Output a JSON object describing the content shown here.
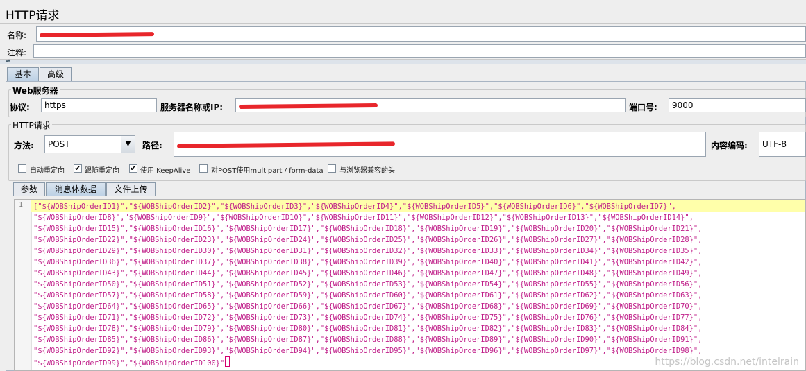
{
  "window": {
    "title": "HTTP请求"
  },
  "name_field": {
    "label": "名称:",
    "value": ""
  },
  "comment_field": {
    "label": "注释:",
    "value": ""
  },
  "tabs_top": [
    {
      "label": "基本",
      "active": true
    },
    {
      "label": "高级",
      "active": false
    }
  ],
  "web_server": {
    "group_label": "Web服务器",
    "protocol_label": "协议:",
    "protocol_value": "https",
    "server_label": "服务器名称或IP:",
    "server_value": "",
    "port_label": "端口号:",
    "port_value": "9000"
  },
  "http_request": {
    "group_label": "HTTP请求",
    "method_label": "方法:",
    "method_value": "POST",
    "path_label": "路径:",
    "path_value": "",
    "encoding_label": "内容编码:",
    "encoding_value": "UTF-8"
  },
  "options": [
    {
      "label": "自动重定向",
      "checked": false
    },
    {
      "label": "跟随重定向",
      "checked": true
    },
    {
      "label": "使用 KeepAlive",
      "checked": true
    },
    {
      "label": "对POST使用multipart / form-data",
      "checked": false
    },
    {
      "label": "与浏览器兼容的头",
      "checked": false
    }
  ],
  "tabs_body": [
    {
      "label": "参数",
      "active": false
    },
    {
      "label": "消息体数据",
      "active": true
    },
    {
      "label": "文件上传",
      "active": false
    }
  ],
  "editor": {
    "line_number": "1",
    "lines": [
      "[\"${WOBShipOrderID1}\",\"${WOBShipOrderID2}\",\"${WOBShipOrderID3}\",\"${WOBShipOrderID4}\",\"${WOBShipOrderID5}\",\"${WOBShipOrderID6}\",\"${WOBShipOrderID7}\",",
      "\"${WOBShipOrderID8}\",\"${WOBShipOrderID9}\",\"${WOBShipOrderID10}\",\"${WOBShipOrderID11}\",\"${WOBShipOrderID12}\",\"${WOBShipOrderID13}\",\"${WOBShipOrderID14}\",",
      "\"${WOBShipOrderID15}\",\"${WOBShipOrderID16}\",\"${WOBShipOrderID17}\",\"${WOBShipOrderID18}\",\"${WOBShipOrderID19}\",\"${WOBShipOrderID20}\",\"${WOBShipOrderID21}\",",
      "\"${WOBShipOrderID22}\",\"${WOBShipOrderID23}\",\"${WOBShipOrderID24}\",\"${WOBShipOrderID25}\",\"${WOBShipOrderID26}\",\"${WOBShipOrderID27}\",\"${WOBShipOrderID28}\",",
      "\"${WOBShipOrderID29}\",\"${WOBShipOrderID30}\",\"${WOBShipOrderID31}\",\"${WOBShipOrderID32}\",\"${WOBShipOrderID33}\",\"${WOBShipOrderID34}\",\"${WOBShipOrderID35}\",",
      "\"${WOBShipOrderID36}\",\"${WOBShipOrderID37}\",\"${WOBShipOrderID38}\",\"${WOBShipOrderID39}\",\"${WOBShipOrderID40}\",\"${WOBShipOrderID41}\",\"${WOBShipOrderID42}\",",
      "\"${WOBShipOrderID43}\",\"${WOBShipOrderID44}\",\"${WOBShipOrderID45}\",\"${WOBShipOrderID46}\",\"${WOBShipOrderID47}\",\"${WOBShipOrderID48}\",\"${WOBShipOrderID49}\",",
      "\"${WOBShipOrderID50}\",\"${WOBShipOrderID51}\",\"${WOBShipOrderID52}\",\"${WOBShipOrderID53}\",\"${WOBShipOrderID54}\",\"${WOBShipOrderID55}\",\"${WOBShipOrderID56}\",",
      "\"${WOBShipOrderID57}\",\"${WOBShipOrderID58}\",\"${WOBShipOrderID59}\",\"${WOBShipOrderID60}\",\"${WOBShipOrderID61}\",\"${WOBShipOrderID62}\",\"${WOBShipOrderID63}\",",
      "\"${WOBShipOrderID64}\",\"${WOBShipOrderID65}\",\"${WOBShipOrderID66}\",\"${WOBShipOrderID67}\",\"${WOBShipOrderID68}\",\"${WOBShipOrderID69}\",\"${WOBShipOrderID70}\",",
      "\"${WOBShipOrderID71}\",\"${WOBShipOrderID72}\",\"${WOBShipOrderID73}\",\"${WOBShipOrderID74}\",\"${WOBShipOrderID75}\",\"${WOBShipOrderID76}\",\"${WOBShipOrderID77}\",",
      "\"${WOBShipOrderID78}\",\"${WOBShipOrderID79}\",\"${WOBShipOrderID80}\",\"${WOBShipOrderID81}\",\"${WOBShipOrderID82}\",\"${WOBShipOrderID83}\",\"${WOBShipOrderID84}\",",
      "\"${WOBShipOrderID85}\",\"${WOBShipOrderID86}\",\"${WOBShipOrderID87}\",\"${WOBShipOrderID88}\",\"${WOBShipOrderID89}\",\"${WOBShipOrderID90}\",\"${WOBShipOrderID91}\",",
      "\"${WOBShipOrderID92}\",\"${WOBShipOrderID93}\",\"${WOBShipOrderID94}\",\"${WOBShipOrderID95}\",\"${WOBShipOrderID96}\",\"${WOBShipOrderID97}\",\"${WOBShipOrderID98}\",",
      "\"${WOBShipOrderID99}\",\"${WOBShipOrderID100}\""
    ]
  },
  "watermark": "https://blog.csdn.net/intelrain",
  "colors": {
    "code_text": "#c0208a",
    "line_highlight": "#ffffaa",
    "redaction": "#e8262b"
  }
}
